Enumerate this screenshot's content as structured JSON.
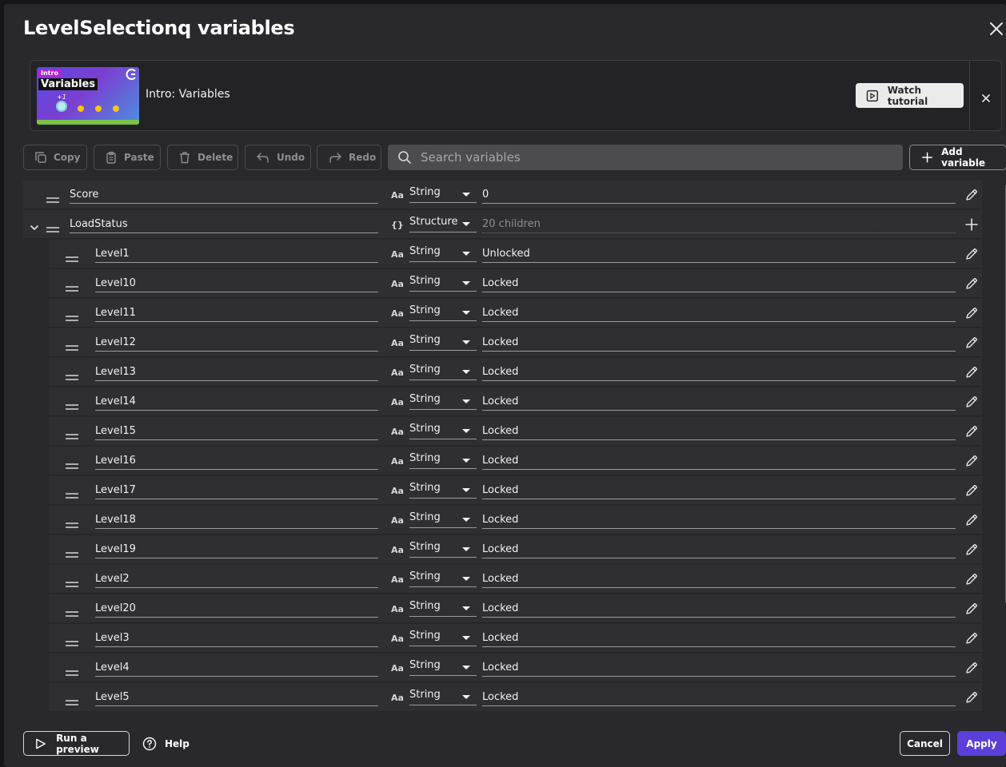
{
  "dialog": {
    "title": "LevelSelectionq variables"
  },
  "tutorial": {
    "thumbnail_tag": "Intro",
    "thumbnail_word": "Variables",
    "thumbnail_plus": "+1",
    "title": "Intro: Variables",
    "watch_label": "Watch tutorial"
  },
  "toolbar": {
    "copy": "Copy",
    "paste": "Paste",
    "delete": "Delete",
    "undo": "Undo",
    "redo": "Redo",
    "search_placeholder": "Search variables",
    "add_variable": "Add variable"
  },
  "type_icons": {
    "string": "Aa",
    "structure": "{}"
  },
  "variables": [
    {
      "name": "Score",
      "type": "String",
      "value": "0"
    },
    {
      "name": "LoadStatus",
      "type": "Structure",
      "value": "20 children"
    }
  ],
  "children": [
    {
      "name": "Level1",
      "type": "String",
      "value": "Unlocked"
    },
    {
      "name": "Level10",
      "type": "String",
      "value": "Locked"
    },
    {
      "name": "Level11",
      "type": "String",
      "value": "Locked"
    },
    {
      "name": "Level12",
      "type": "String",
      "value": "Locked"
    },
    {
      "name": "Level13",
      "type": "String",
      "value": "Locked"
    },
    {
      "name": "Level14",
      "type": "String",
      "value": "Locked"
    },
    {
      "name": "Level15",
      "type": "String",
      "value": "Locked"
    },
    {
      "name": "Level16",
      "type": "String",
      "value": "Locked"
    },
    {
      "name": "Level17",
      "type": "String",
      "value": "Locked"
    },
    {
      "name": "Level18",
      "type": "String",
      "value": "Locked"
    },
    {
      "name": "Level19",
      "type": "String",
      "value": "Locked"
    },
    {
      "name": "Level2",
      "type": "String",
      "value": "Locked"
    },
    {
      "name": "Level20",
      "type": "String",
      "value": "Locked"
    },
    {
      "name": "Level3",
      "type": "String",
      "value": "Locked"
    },
    {
      "name": "Level4",
      "type": "String",
      "value": "Locked"
    },
    {
      "name": "Level5",
      "type": "String",
      "value": "Locked"
    }
  ],
  "footer": {
    "run_preview": "Run a preview",
    "help": "Help",
    "cancel": "Cancel",
    "apply": "Apply"
  },
  "colors": {
    "accent": "#5b3fd8",
    "background": "#29292d",
    "row": "#2e2e33"
  }
}
